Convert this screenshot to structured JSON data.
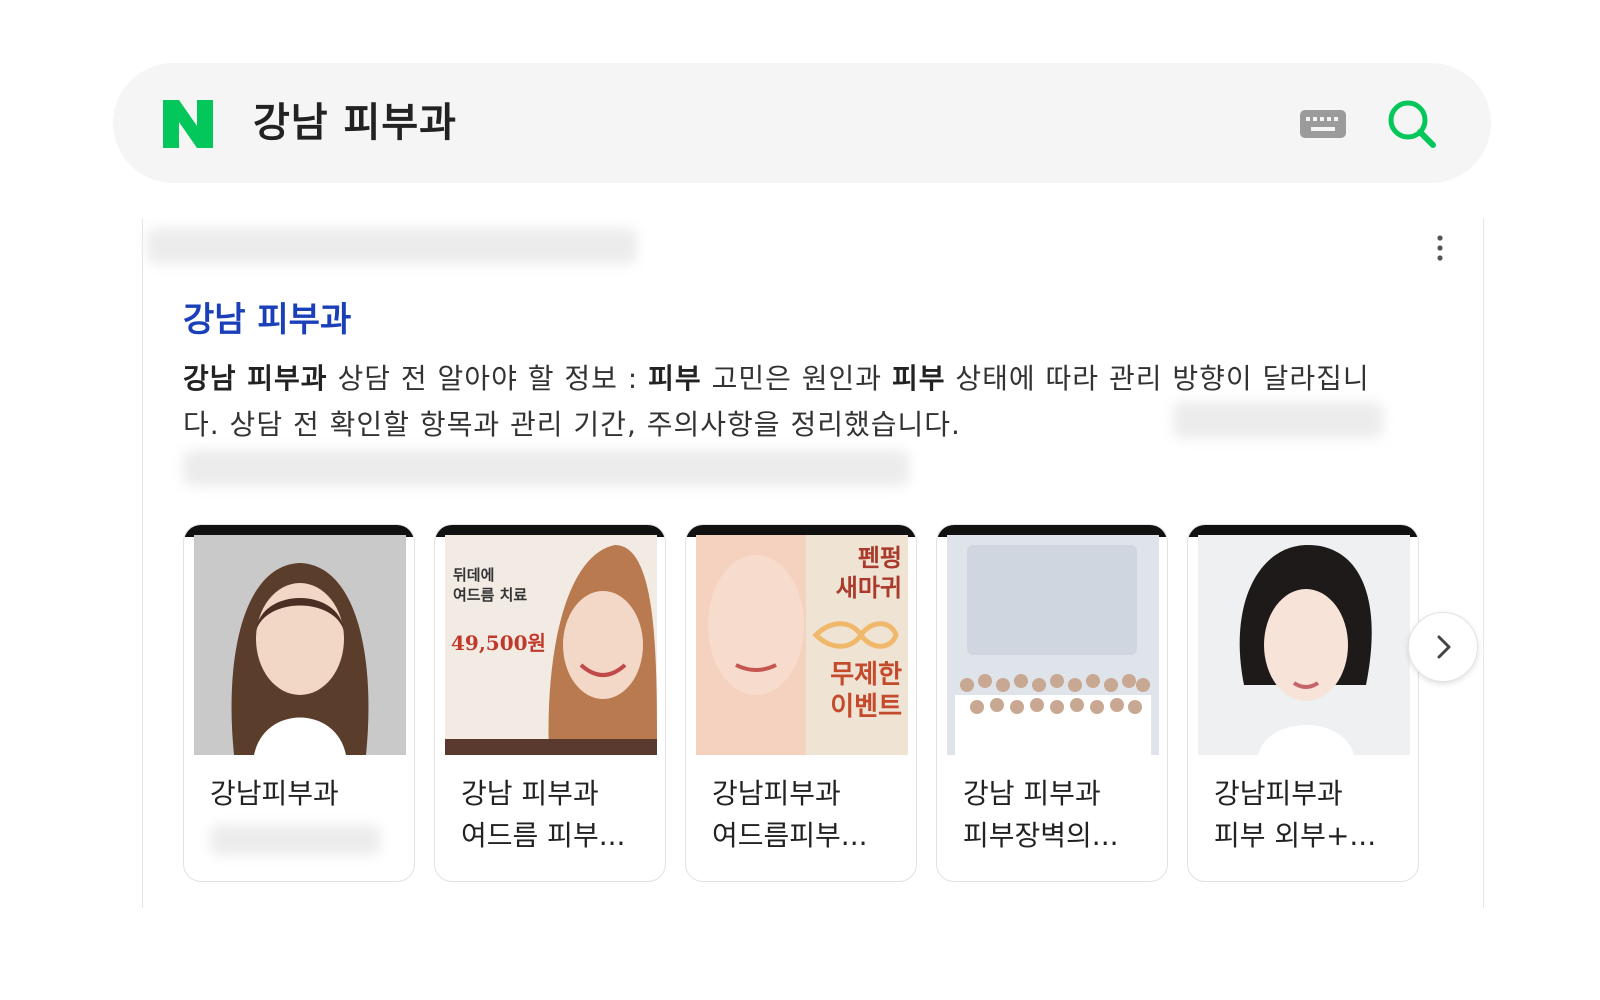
{
  "search": {
    "query": "강남 피부과",
    "logo_letter": "N",
    "icons": {
      "keyboard": "keyboard-icon",
      "search": "search-icon"
    }
  },
  "colors": {
    "brand": "#03c75a",
    "title_link": "#1a3fb8"
  },
  "result": {
    "title": "강남 피부과",
    "description": {
      "p1_bold": "강남 피부과",
      "p2": " 상담 전 알아야 할 정보 : ",
      "p3_bold": "피부",
      "p4": " 고민은 원인과 ",
      "p5_bold": "피부",
      "p6": " 상태에 따라 관리 방향이 달라집니다. 상담 전 확인할 항목과 관리 기간, 주의사항을 정리했습니다."
    },
    "more_icon": "more-vertical-icon",
    "thumbnails": [
      {
        "line1": "강남피부과",
        "line2": ""
      },
      {
        "line1": "강남 피부과",
        "line2": "여드름 피부..."
      },
      {
        "line1": "강남피부과",
        "line2": "여드름피부..."
      },
      {
        "line1": "강남 피부과",
        "line2": "피부장벽의..."
      },
      {
        "line1": "강남피부과",
        "line2": "피부 외부+..."
      }
    ],
    "ad_image": {
      "price": "49,500원",
      "heading1": "뒤데에",
      "heading2": "여드름 치료",
      "event1": "펜펑",
      "event2": "새마귀",
      "event3": "무제한",
      "event4": "이벤트"
    },
    "next_icon": "chevron-right-icon"
  }
}
